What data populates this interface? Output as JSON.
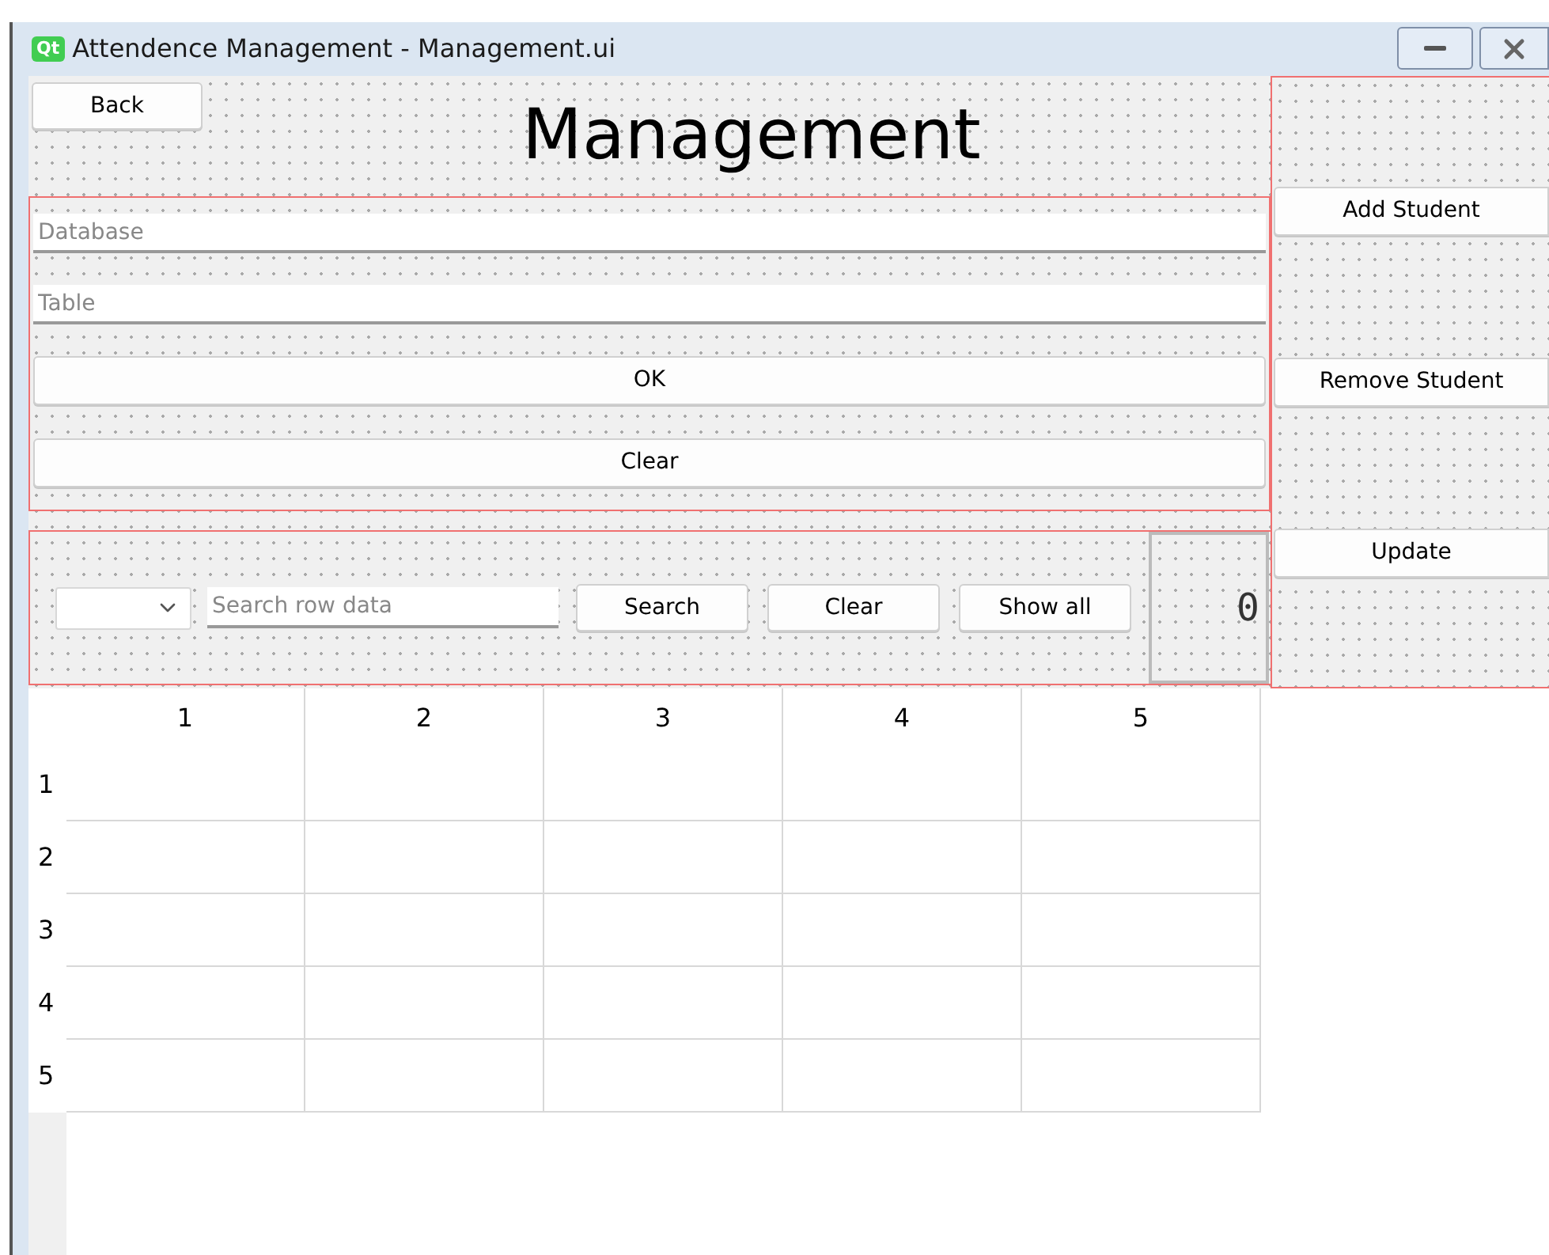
{
  "window": {
    "title": "Attendence Management - Management.ui",
    "icon_label": "Qt"
  },
  "back_button": "Back",
  "heading": "Management",
  "connection": {
    "database_placeholder": "Database",
    "table_placeholder": "Table",
    "ok_button": "OK",
    "clear_button": "Clear"
  },
  "search": {
    "placeholder": "Search row data",
    "buttons": [
      "Search",
      "Clear",
      "Show all"
    ],
    "counter": "0"
  },
  "side_buttons": [
    "Add Student",
    "Remove Student",
    "Update"
  ],
  "table": {
    "columns": [
      "1",
      "2",
      "3",
      "4",
      "5"
    ],
    "rows": [
      {
        "header": "1"
      },
      {
        "header": "2"
      },
      {
        "header": "3"
      },
      {
        "header": "4"
      },
      {
        "header": "5"
      }
    ]
  }
}
